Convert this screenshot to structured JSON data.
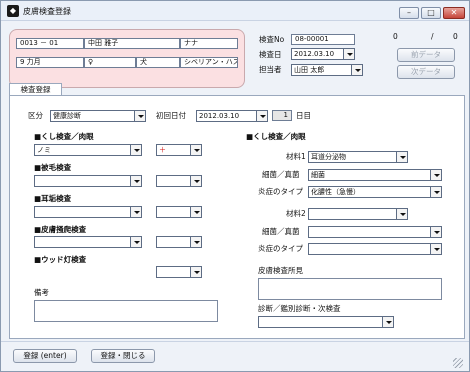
{
  "window": {
    "title": "皮膚検査登録",
    "icon": "app-icon"
  },
  "patient": {
    "id": "0013 － 01",
    "owner": "中田 雅子",
    "pet_name": "ナナ",
    "age": "9 力月",
    "sex": "♀",
    "species": "犬",
    "breed": "シベリアン・ハスキー"
  },
  "header": {
    "exam_no_label": "検査No",
    "exam_no": "08-00001",
    "exam_date_label": "検査日",
    "exam_date": "2012.03.10",
    "staff_label": "担当者",
    "staff": "山田 太郎",
    "counter": "0",
    "counter_sep": "/",
    "counter_total": "0",
    "prev_btn": "前データ",
    "next_btn": "次データ"
  },
  "tab": {
    "label": "検査登録"
  },
  "form": {
    "kubun_label": "区分",
    "kubun_value": "健康診断",
    "first_date_label": "初回日付",
    "first_date": "2012.03.10",
    "day_count": "1",
    "day_unit": "日目",
    "left": {
      "kushi_title": "■くし検査／肉眼",
      "kushi_value": "ノミ",
      "kushi_grade": "＋",
      "hikou_title": "■被毛検査",
      "jiko_title": "■耳垢検査",
      "hifu_title": "■皮膚掻爬検査",
      "wood_title": "■ウッド灯検査",
      "biko_label": "備考"
    },
    "right": {
      "title": "■くし検査／肉眼",
      "material1_label": "材料1",
      "material1_value": "耳道分泌物",
      "fungus1_label": "細菌／真菌",
      "fungus1_value": "細菌",
      "type1_label": "炎症のタイプ",
      "type1_value": "化膿性（急慢）",
      "material2_label": "材料2",
      "fungus2_label": "細菌／真菌",
      "type2_label": "炎症のタイプ",
      "findings_label": "皮膚検査所見",
      "diagnosis_label": "診断／鑑別診断・次検査"
    }
  },
  "footer": {
    "register_btn": "登録 (enter)",
    "register_close_btn": "登録・閉じる"
  }
}
